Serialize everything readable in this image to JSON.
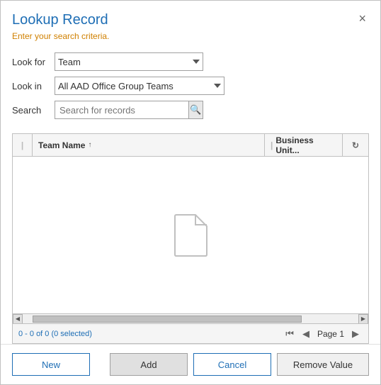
{
  "dialog": {
    "title": "Lookup Record",
    "subtitle": "Enter your search criteria.",
    "close_label": "×"
  },
  "form": {
    "lookfor_label": "Look for",
    "lookin_label": "Look in",
    "search_label": "Search",
    "lookfor_value": "Team",
    "lookin_value": "All AAD Office Group Teams",
    "search_placeholder": "Search for records",
    "lookfor_options": [
      "Team"
    ],
    "lookin_options": [
      "All AAD Office Group Teams"
    ]
  },
  "table": {
    "col_teamname": "Team Name",
    "col_businessunit": "Business Unit...",
    "sort_arrow": "↑",
    "record_count": "0 - 0 of 0 (0 selected)",
    "page_label": "Page 1"
  },
  "buttons": {
    "new_label": "New",
    "add_label": "Add",
    "cancel_label": "Cancel",
    "remove_label": "Remove Value"
  },
  "pagination": {
    "first": "⏮",
    "prev": "◀",
    "next": "▶"
  }
}
